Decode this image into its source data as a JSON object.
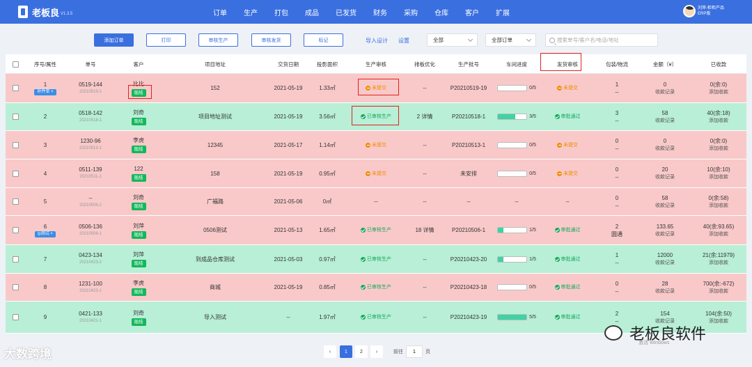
{
  "app": {
    "name": "老板良",
    "version": "V1.3.5"
  },
  "nav": [
    "订单",
    "生产",
    "打包",
    "成品",
    "已发货",
    "财务",
    "采购",
    "仓库",
    "客户",
    "扩展"
  ],
  "user": {
    "line1": "刘萍-柜柜产品",
    "line2": "ERP版"
  },
  "toolbar": {
    "add_order": "添加订单",
    "print": "打印",
    "review_production": "审核生产",
    "review_shipping": "审核发货",
    "mark": "标记",
    "import_design": "导入设计",
    "settings": "设置",
    "filter1": "全部",
    "filter2": "全部订单",
    "search_placeholder": "搜索单号/客户名/电话/地址"
  },
  "columns": [
    "序号/属性",
    "单号",
    "客户",
    "项目地址",
    "交货日期",
    "投影面积",
    "生产审核",
    "排板优化",
    "生产批号",
    "车间进度",
    "发货审核",
    "包装/物流",
    "金额（¥）",
    "已收款"
  ],
  "rows": [
    {
      "color": "pink",
      "idx": "1",
      "tag": "补件单 ×",
      "order": "0519-144",
      "order_sub": "20210519-1",
      "customer": "比比",
      "cust_tag": "现结",
      "address": "152",
      "date": "2021-05-19",
      "area": "1.33㎡",
      "prod_status": "未提交",
      "prod_ok": false,
      "layout": "--",
      "batch": "P20210519-19",
      "progress": "0/5",
      "progress_pct": 0,
      "ship_status": "未提交",
      "ship_ok": false,
      "pack1": "1",
      "pack2": "--",
      "amount": "0",
      "amount_link": "收款记录",
      "paid": "0(余:0)",
      "paid_link": "添加收款"
    },
    {
      "color": "green",
      "idx": "2",
      "tag": "",
      "order": "0518-142",
      "order_sub": "20210518-1",
      "customer": "刘奇",
      "cust_tag": "现结",
      "address": "项目地址测试",
      "date": "2021-05-19",
      "area": "3.56㎡",
      "prod_status": "已审核生产",
      "prod_ok": true,
      "layout": "2 详情",
      "batch": "P20210518-1",
      "progress": "3/5",
      "progress_pct": 60,
      "ship_status": "审批通过",
      "ship_ok": true,
      "pack1": "3",
      "pack2": "--",
      "amount": "58",
      "amount_link": "收款记录",
      "paid": "40(余:18)",
      "paid_link": "添加收款"
    },
    {
      "color": "pink",
      "idx": "3",
      "tag": "",
      "order": "1230-96",
      "order_sub": "20210513-1",
      "customer": "李虎",
      "cust_tag": "现结",
      "address": "12345",
      "date": "2021-05-17",
      "area": "1.14㎡",
      "prod_status": "未提交",
      "prod_ok": false,
      "layout": "--",
      "batch": "P20210513-1",
      "progress": "0/5",
      "progress_pct": 0,
      "ship_status": "未提交",
      "ship_ok": false,
      "pack1": "0",
      "pack2": "--",
      "amount": "0",
      "amount_link": "收款记录",
      "paid": "0(余:0)",
      "paid_link": "添加收款"
    },
    {
      "color": "pink",
      "idx": "4",
      "tag": "",
      "order": "0511-139",
      "order_sub": "20210511-1",
      "customer": "122",
      "cust_tag": "现结",
      "address": "158",
      "date": "2021-05-19",
      "area": "0.95㎡",
      "prod_status": "未提交",
      "prod_ok": false,
      "layout": "--",
      "batch": "未安排",
      "progress": "0/5",
      "progress_pct": 0,
      "ship_status": "未提交",
      "ship_ok": false,
      "pack1": "0",
      "pack2": "--",
      "amount": "20",
      "amount_link": "收款记录",
      "paid": "10(余:10)",
      "paid_link": "添加收款"
    },
    {
      "color": "pink",
      "idx": "5",
      "tag": "",
      "order": "--",
      "order_sub": "20210506-2",
      "customer": "刘奇",
      "cust_tag": "现结",
      "address": "广福路",
      "date": "2021-05-06",
      "area": "0㎡",
      "prod_status": "--",
      "prod_ok": null,
      "layout": "--",
      "batch": "--",
      "progress": "--",
      "progress_pct": null,
      "ship_status": "--",
      "ship_ok": null,
      "pack1": "0",
      "pack2": "--",
      "amount": "58",
      "amount_link": "收款记录",
      "paid": "0(余:58)",
      "paid_link": "添加收款"
    },
    {
      "color": "pink",
      "idx": "6",
      "tag": "lp测试 ×",
      "order": "0506-136",
      "order_sub": "20210506-1",
      "customer": "刘萍",
      "cust_tag": "现结",
      "address": "0506测试",
      "date": "2021-05-13",
      "area": "1.65㎡",
      "prod_status": "已审核生产",
      "prod_ok": true,
      "layout": "18 详情",
      "batch": "P20210506-1",
      "progress": "1/5",
      "progress_pct": 20,
      "ship_status": "审批通过",
      "ship_ok": true,
      "pack1": "2",
      "pack2": "圆通",
      "amount": "133.65",
      "amount_link": "收款记录",
      "paid": "40(余:93.65)",
      "paid_link": "添加收款"
    },
    {
      "color": "green",
      "idx": "7",
      "tag": "",
      "order": "0423-134",
      "order_sub": "20210423-2",
      "customer": "刘萍",
      "cust_tag": "现结",
      "address": "到成品仓库测试",
      "date": "2021-05-03",
      "area": "0.97㎡",
      "prod_status": "已审核生产",
      "prod_ok": true,
      "layout": "--",
      "batch": "P20210423-20",
      "progress": "1/5",
      "progress_pct": 20,
      "ship_status": "审批通过",
      "ship_ok": true,
      "pack1": "1",
      "pack2": "--",
      "amount": "12000",
      "amount_link": "收款记录",
      "paid": "21(余:11979)",
      "paid_link": "添加收款"
    },
    {
      "color": "pink",
      "idx": "8",
      "tag": "",
      "order": "1231-100",
      "order_sub": "20210423-1",
      "customer": "李虎",
      "cust_tag": "现结",
      "address": "商城",
      "date": "2021-05-19",
      "area": "0.85㎡",
      "prod_status": "已审核生产",
      "prod_ok": true,
      "layout": "--",
      "batch": "P20210423-18",
      "progress": "0/5",
      "progress_pct": 0,
      "ship_status": "审批通过",
      "ship_ok": true,
      "pack1": "0",
      "pack2": "--",
      "amount": "28",
      "amount_link": "收款记录",
      "paid": "700(余:-672)",
      "paid_link": "添加收款"
    },
    {
      "color": "green",
      "idx": "9",
      "tag": "",
      "order": "0421-133",
      "order_sub": "20210421-1",
      "customer": "刘奇",
      "cust_tag": "现结",
      "address": "导入测试",
      "date": "--",
      "area": "1.97㎡",
      "prod_status": "已审核生产",
      "prod_ok": true,
      "layout": "--",
      "batch": "P20210423-19",
      "progress": "5/5",
      "progress_pct": 100,
      "ship_status": "审批通过",
      "ship_ok": true,
      "pack1": "2",
      "pack2": "--",
      "amount": "154",
      "amount_link": "收款记录",
      "paid": "104(余:50)",
      "paid_link": "添加收款"
    }
  ],
  "pagination": {
    "prev": "‹",
    "pages": [
      "1",
      "2"
    ],
    "next": "›",
    "goto_label": "前往",
    "goto_value": "1",
    "page_unit": "页"
  },
  "watermark": {
    "left": "大数跨境",
    "right": "老板良软件",
    "right_sub": "激活 Windows"
  },
  "colors": {
    "primary": "#3a6fe0",
    "row_pink": "#f9c9c9",
    "row_green": "#b8efd6",
    "status_orange": "#f08c00",
    "status_green": "#12a85a"
  }
}
